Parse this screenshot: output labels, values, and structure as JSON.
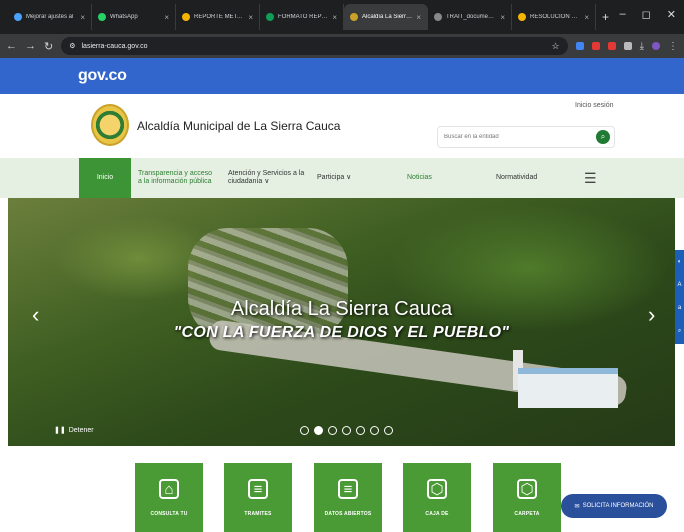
{
  "browser": {
    "tabs": [
      {
        "label": "Mejorar ajustes al"
      },
      {
        "label": "WhatsApp"
      },
      {
        "label": "REPORTE METAS MI"
      },
      {
        "label": "FORMATO REPORT"
      },
      {
        "label": "Alcaldía La Sierra Ca",
        "active": true
      },
      {
        "label": "TRAIT_documento"
      },
      {
        "label": "RESOLUCION PLAN"
      }
    ],
    "new_tab": "+",
    "url": "lasierra-cauca.gov.co",
    "window_controls": [
      "–",
      "◻",
      "✕"
    ]
  },
  "gov": {
    "logo": "gov.co"
  },
  "header": {
    "municipality": "Alcaldía Municipal de La Sierra Cauca",
    "login": "Inicio sesión",
    "search_placeholder": "Buscar en la entidad"
  },
  "nav": {
    "home": "Inicio",
    "transparency": [
      "Transparencia y acceso",
      "a la información pública"
    ],
    "attention": [
      "Atención y Servicios a la",
      "ciudadanía ∨"
    ],
    "participa": "Participa ∨",
    "news": "Noticias",
    "normativity": "Normatividad",
    "menu_icon": "☰"
  },
  "hero": {
    "title": "Alcaldía La Sierra Cauca",
    "subtitle": "\"CON LA FUERZA DE DIOS Y EL PUEBLO\"",
    "pause_label": "Detener",
    "slide_count": 7,
    "active_slide": 2
  },
  "tiles": [
    {
      "label": "CONSULTA TU",
      "icon": "home-icon"
    },
    {
      "label": "TRAMITES",
      "icon": "document-icon"
    },
    {
      "label": "DATOS ABIERTOS",
      "icon": "document-icon"
    },
    {
      "label": "CAJA DE",
      "icon": "box-icon"
    },
    {
      "label": "CARPETA",
      "icon": "box-icon"
    }
  ],
  "solicit": {
    "label": "SOLICITA INFORMACIÓN"
  },
  "colors": {
    "gov_blue": "#3366cc",
    "brand_green": "#3d9436",
    "solicit_blue": "#2a4f9b"
  }
}
